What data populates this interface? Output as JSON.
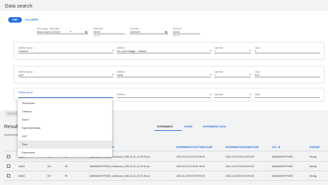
{
  "page": {
    "title": "Data search"
  },
  "toolbar": {
    "and_label": "AND",
    "collapse_label": "COLLAPSE"
  },
  "time_row": {
    "time_range": {
      "label": "Time range",
      "value": "Since start"
    },
    "start_date": {
      "label": "Start date *",
      "value": "1/1/2019"
    },
    "start_time": {
      "label": "Start time",
      "value": "00:00",
      "helper": "hh:mm"
    },
    "end_date": {
      "label": "End date *",
      "value": "1/9/2023"
    },
    "end_time": {
      "label": "End time",
      "value": "13:06",
      "helper": "hh:mm"
    }
  },
  "filters": [
    {
      "attribute_group": {
        "label": "Attribute group",
        "value": "Channel"
      },
      "attribute": {
        "label": "Attribute",
        "value": "DC Link Voltage - Filtered"
      },
      "operator": {
        "label": "Operator",
        "value": ">"
      },
      "value": {
        "label": "Value",
        "value": "1"
      }
    },
    {
      "attribute_group": {
        "label": "Attribute group",
        "value": "UUT"
      },
      "attribute": {
        "label": "Attribute",
        "value": "UUID"
      },
      "operator": {
        "label": "Operator",
        "value": "="
      },
      "value": {
        "label": "Value",
        "value": "374"
      }
    },
    {
      "attribute_group": {
        "label": "Attribute group",
        "value": ""
      },
      "attribute": {
        "label": "Attribute",
        "value": ""
      },
      "operator": {
        "label": "Operator",
        "value": ""
      },
      "value": {
        "label": "Value",
        "value": ""
      }
    }
  ],
  "dropdown": {
    "items": [
      "TimeSeries",
      "Channel",
      "Event",
      "ExperimentData",
      "UUT",
      "Time",
      "Experiment"
    ],
    "highlighted": "Time"
  },
  "search_button": {
    "label": "SEARCH"
  },
  "results": {
    "title": "Results",
    "subtitle": "Experiment",
    "tabs": [
      "EXPERIMENT",
      "EVENT",
      "EXPERIMENT DATA"
    ],
    "active_tab": "EXPERIMENT",
    "columns": [
      "",
      "",
      "",
      "",
      "",
      "EXPERIMENTSTARTTIMESTAMP",
      "EXPERIMENTENDTIMESTAMP",
      "UUT_ID",
      "SYMODE"
    ],
    "partial_column": "E",
    "rows": [
      [
        "54402",
        "374",
        "99",
        "SABHA08YF0P4092_Continuous_2020-10-01_14-30-00.csv",
        "2020-10-01T14:31:20+00:00",
        "2020-10-01T16:01:20+00:00",
        "SABHA08YF0P4092",
        "Driving"
      ],
      [
        "54403",
        "374",
        "99",
        "SABHA08YF0P4092_Continuous_2020-10-01_22-19-31.csv",
        "2020-10-01T22:15:31+00:00",
        "2020-10-01T23:06:43+00:00",
        "SABHA08YF0P4092",
        "Driving"
      ],
      [
        "54404",
        "374",
        "99",
        "SABHA08YF0P4092_Continuous_2020-11-02_18-37-05.csv",
        "2020-11-02T18:37:05+00:00",
        "2020-11-02T20:04:30+00:00",
        "SABHA08YF0P4092",
        "Driving"
      ]
    ]
  },
  "colors": {
    "accent": "#2a6fdb",
    "background": "#f1f3f4",
    "panel": "#ffffff"
  }
}
